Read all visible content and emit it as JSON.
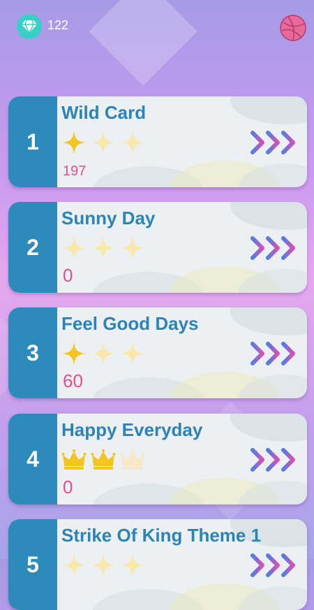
{
  "header": {
    "gem_icon": "diamond-icon",
    "gem_count": "122",
    "ball_icon": "basketball-icon"
  },
  "songs": [
    {
      "number": "1",
      "title": "Wild Card",
      "rating": 1,
      "rating_icon": "star",
      "score": "197"
    },
    {
      "number": "2",
      "title": "Sunny Day",
      "rating": 0,
      "rating_icon": "star",
      "score": "0"
    },
    {
      "number": "3",
      "title": "Feel Good Days",
      "rating": 1,
      "rating_icon": "star",
      "score": "60"
    },
    {
      "number": "4",
      "title": "Happy Everyday",
      "rating": 2,
      "rating_icon": "crown",
      "score": "0"
    },
    {
      "number": "5",
      "title": "Strike Of King Theme 1",
      "rating": 0,
      "rating_icon": "star",
      "score": ""
    }
  ],
  "colors": {
    "number_column": "#2c8bbb",
    "title": "#2b84b6",
    "score": "#e0508e",
    "star_filled": "#f5c51f",
    "star_empty": "#f8e8a9",
    "crown_filled": "#f5c51f",
    "crown_empty": "#f6e7c9"
  }
}
